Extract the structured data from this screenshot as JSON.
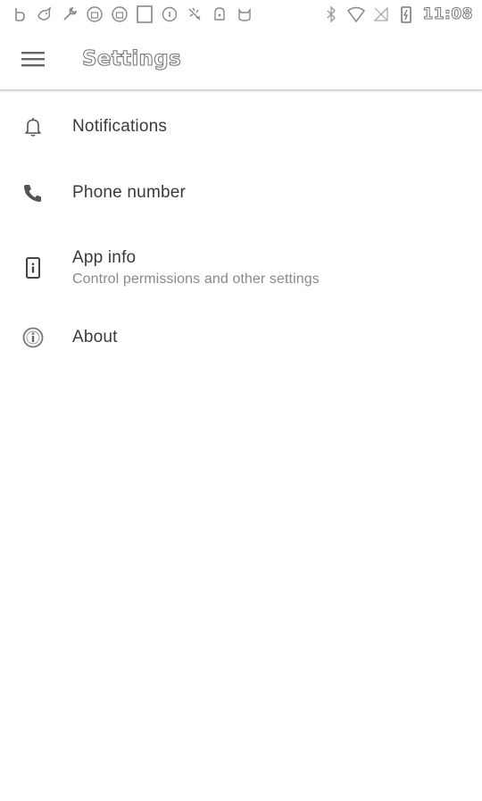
{
  "status_bar": {
    "left_icons": [
      "b-app-icon",
      "bird-app-icon",
      "wrench-icon",
      "lock-app-icon",
      "lock-app-icon-2",
      "square-app-icon",
      "info-circle-icon",
      "puzzle-icon",
      "android-icon",
      "cat-app-icon"
    ],
    "right_icons": [
      "bluetooth-icon",
      "wifi-icon",
      "no-signal-icon",
      "battery-charging-icon"
    ],
    "time": "11:08"
  },
  "app_bar": {
    "menu_icon": "hamburger-menu-icon",
    "title": "Settings"
  },
  "settings": {
    "items": [
      {
        "icon": "bell-icon",
        "title": "Notifications",
        "subtitle": ""
      },
      {
        "icon": "phone-icon",
        "title": "Phone number",
        "subtitle": ""
      },
      {
        "icon": "app-info-icon",
        "title": "App info",
        "subtitle": "Control permissions and other settings"
      },
      {
        "icon": "about-info-icon",
        "title": "About",
        "subtitle": ""
      }
    ]
  },
  "colors": {
    "background": "#ffffff",
    "icon": "#555555",
    "divider": "#d8d8d8",
    "title_text": "#3a3a3a",
    "subtitle_text": "#8a8a8a"
  }
}
